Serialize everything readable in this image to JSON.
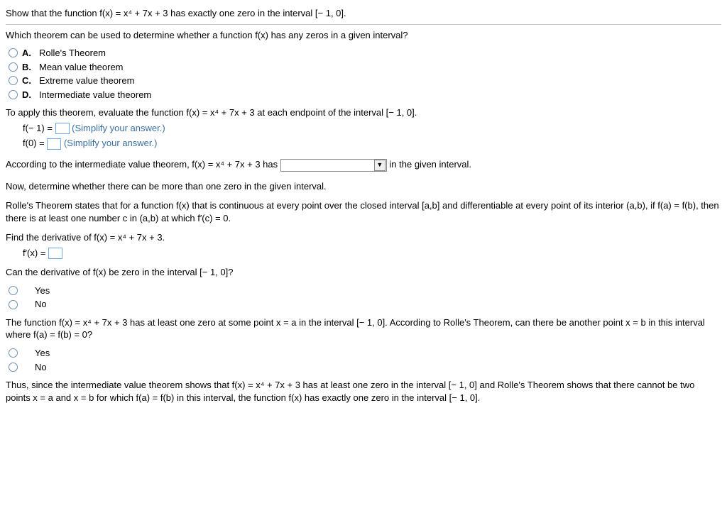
{
  "title": "Show that the function f(x) = x⁴ + 7x + 3 has exactly one zero in the interval [− 1, 0].",
  "q1": {
    "prompt": "Which theorem can be used to determine whether a function f(x) has any zeros in a given interval?",
    "opts": {
      "a": {
        "letter": "A.",
        "text": "Rolle's Theorem"
      },
      "b": {
        "letter": "B.",
        "text": "Mean value theorem"
      },
      "c": {
        "letter": "C.",
        "text": "Extreme value theorem"
      },
      "d": {
        "letter": "D.",
        "text": "Intermediate value theorem"
      }
    }
  },
  "apply_line": "To apply this theorem, evaluate the function f(x) = x⁴ + 7x + 3 at each endpoint of the interval [− 1, 0].",
  "eval": {
    "f_neg1_label": "f(− 1) =",
    "f_0_label": "f(0) =",
    "hint": "(Simplify your answer.)"
  },
  "ivt_line_pre": "According to the intermediate value theorem, f(x) = x⁴ + 7x + 3 has",
  "ivt_line_post": "in the given interval.",
  "select_arrow": "▼",
  "now_line": "Now, determine whether there can be more than one zero in the given interval.",
  "rolle_state": "Rolle's Theorem states that for a function f(x) that is continuous at every point over the closed interval [a,b] and differentiable at every point of its interior (a,b), if f(a) = f(b), then there is at least one number c in (a,b) at which f′(c) = 0.",
  "find_deriv": "Find the derivative of f(x) = x⁴ + 7x + 3.",
  "deriv_label": "f′(x) =",
  "q2": {
    "prompt": "Can the derivative of f(x) be zero in the interval [− 1, 0]?",
    "yes": "Yes",
    "no": "No"
  },
  "q3": {
    "prompt": "The function f(x) = x⁴ + 7x + 3 has at least one zero at some point x = a in the interval [− 1, 0]. According to Rolle's Theorem, can there be another point x = b in this interval where f(a) = f(b) = 0?",
    "yes": "Yes",
    "no": "No"
  },
  "conclusion": "Thus, since the intermediate value theorem shows that f(x) = x⁴ + 7x + 3 has at least one zero in the interval [− 1, 0] and Rolle's Theorem shows that there cannot be two points x = a and x = b for which f(a) = f(b) in this interval, the function f(x) has exactly one zero in the interval [− 1, 0]."
}
